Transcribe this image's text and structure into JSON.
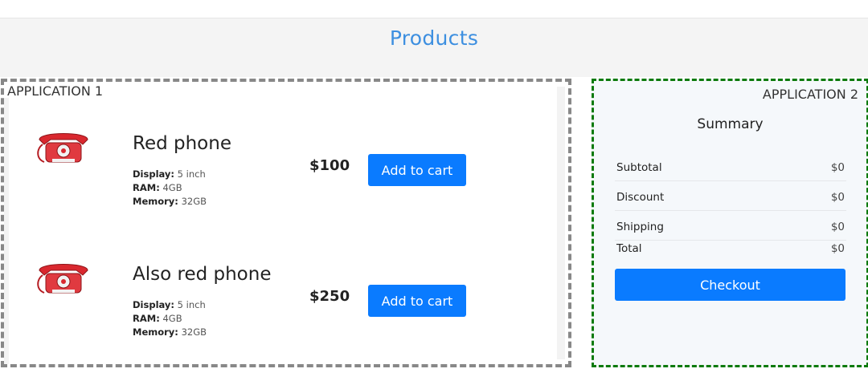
{
  "header": {
    "title": "Products"
  },
  "app1": {
    "label": "APPLICATION 1",
    "products": [
      {
        "name": "Red phone",
        "image_icon": "red-phone-icon",
        "specs": [
          {
            "key": "Display:",
            "value": "5 inch"
          },
          {
            "key": "RAM:",
            "value": "4GB"
          },
          {
            "key": "Memory:",
            "value": "32GB"
          }
        ],
        "price": "$100",
        "button_label": "Add to cart"
      },
      {
        "name": "Also red phone",
        "image_icon": "red-phone-icon",
        "specs": [
          {
            "key": "Display:",
            "value": "5 inch"
          },
          {
            "key": "RAM:",
            "value": "4GB"
          },
          {
            "key": "Memory:",
            "value": "32GB"
          }
        ],
        "price": "$250",
        "button_label": "Add to cart"
      }
    ]
  },
  "app2": {
    "label": "APPLICATION 2",
    "summary": {
      "title": "Summary",
      "rows": [
        {
          "label": "Subtotal",
          "value": "$0"
        },
        {
          "label": "Discount",
          "value": "$0"
        },
        {
          "label": "Shipping",
          "value": "$0"
        },
        {
          "label": "Total",
          "value": "$0"
        }
      ],
      "checkout_label": "Checkout"
    }
  },
  "colors": {
    "accent": "#0a7bff",
    "title_blue": "#3d8fe0",
    "app1_border": "#888888",
    "app2_border": "#0c7a0c",
    "phone_red": "#d9282f"
  }
}
